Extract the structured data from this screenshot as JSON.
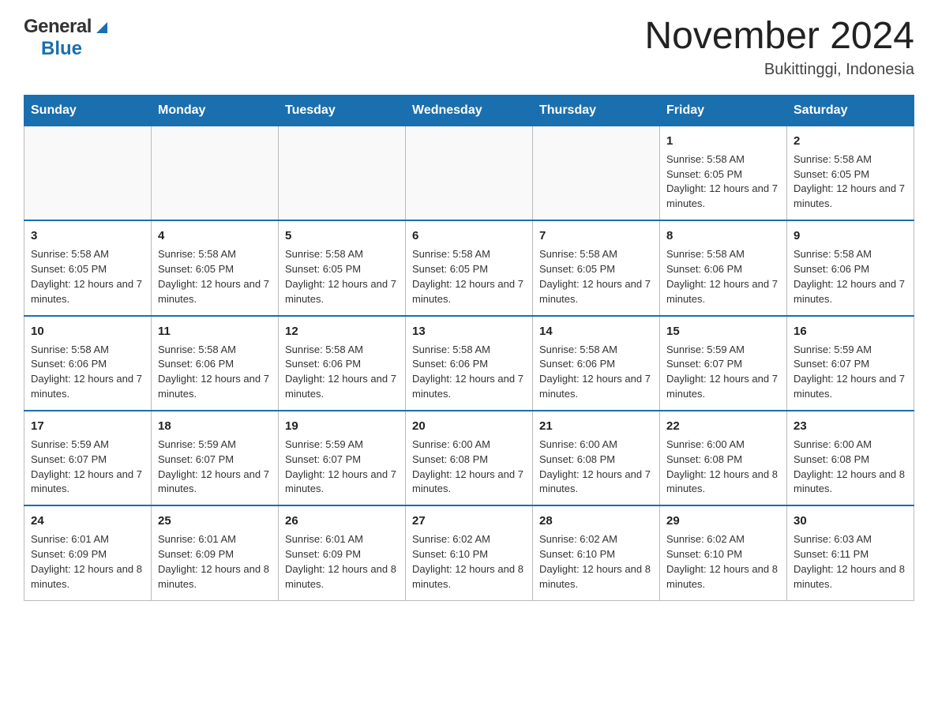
{
  "header": {
    "logo_general": "General",
    "logo_blue": "Blue",
    "title": "November 2024",
    "location": "Bukittinggi, Indonesia"
  },
  "calendar": {
    "days_of_week": [
      "Sunday",
      "Monday",
      "Tuesday",
      "Wednesday",
      "Thursday",
      "Friday",
      "Saturday"
    ],
    "weeks": [
      [
        {
          "day": "",
          "info": ""
        },
        {
          "day": "",
          "info": ""
        },
        {
          "day": "",
          "info": ""
        },
        {
          "day": "",
          "info": ""
        },
        {
          "day": "",
          "info": ""
        },
        {
          "day": "1",
          "info": "Sunrise: 5:58 AM\nSunset: 6:05 PM\nDaylight: 12 hours and 7 minutes."
        },
        {
          "day": "2",
          "info": "Sunrise: 5:58 AM\nSunset: 6:05 PM\nDaylight: 12 hours and 7 minutes."
        }
      ],
      [
        {
          "day": "3",
          "info": "Sunrise: 5:58 AM\nSunset: 6:05 PM\nDaylight: 12 hours and 7 minutes."
        },
        {
          "day": "4",
          "info": "Sunrise: 5:58 AM\nSunset: 6:05 PM\nDaylight: 12 hours and 7 minutes."
        },
        {
          "day": "5",
          "info": "Sunrise: 5:58 AM\nSunset: 6:05 PM\nDaylight: 12 hours and 7 minutes."
        },
        {
          "day": "6",
          "info": "Sunrise: 5:58 AM\nSunset: 6:05 PM\nDaylight: 12 hours and 7 minutes."
        },
        {
          "day": "7",
          "info": "Sunrise: 5:58 AM\nSunset: 6:05 PM\nDaylight: 12 hours and 7 minutes."
        },
        {
          "day": "8",
          "info": "Sunrise: 5:58 AM\nSunset: 6:06 PM\nDaylight: 12 hours and 7 minutes."
        },
        {
          "day": "9",
          "info": "Sunrise: 5:58 AM\nSunset: 6:06 PM\nDaylight: 12 hours and 7 minutes."
        }
      ],
      [
        {
          "day": "10",
          "info": "Sunrise: 5:58 AM\nSunset: 6:06 PM\nDaylight: 12 hours and 7 minutes."
        },
        {
          "day": "11",
          "info": "Sunrise: 5:58 AM\nSunset: 6:06 PM\nDaylight: 12 hours and 7 minutes."
        },
        {
          "day": "12",
          "info": "Sunrise: 5:58 AM\nSunset: 6:06 PM\nDaylight: 12 hours and 7 minutes."
        },
        {
          "day": "13",
          "info": "Sunrise: 5:58 AM\nSunset: 6:06 PM\nDaylight: 12 hours and 7 minutes."
        },
        {
          "day": "14",
          "info": "Sunrise: 5:58 AM\nSunset: 6:06 PM\nDaylight: 12 hours and 7 minutes."
        },
        {
          "day": "15",
          "info": "Sunrise: 5:59 AM\nSunset: 6:07 PM\nDaylight: 12 hours and 7 minutes."
        },
        {
          "day": "16",
          "info": "Sunrise: 5:59 AM\nSunset: 6:07 PM\nDaylight: 12 hours and 7 minutes."
        }
      ],
      [
        {
          "day": "17",
          "info": "Sunrise: 5:59 AM\nSunset: 6:07 PM\nDaylight: 12 hours and 7 minutes."
        },
        {
          "day": "18",
          "info": "Sunrise: 5:59 AM\nSunset: 6:07 PM\nDaylight: 12 hours and 7 minutes."
        },
        {
          "day": "19",
          "info": "Sunrise: 5:59 AM\nSunset: 6:07 PM\nDaylight: 12 hours and 7 minutes."
        },
        {
          "day": "20",
          "info": "Sunrise: 6:00 AM\nSunset: 6:08 PM\nDaylight: 12 hours and 7 minutes."
        },
        {
          "day": "21",
          "info": "Sunrise: 6:00 AM\nSunset: 6:08 PM\nDaylight: 12 hours and 7 minutes."
        },
        {
          "day": "22",
          "info": "Sunrise: 6:00 AM\nSunset: 6:08 PM\nDaylight: 12 hours and 8 minutes."
        },
        {
          "day": "23",
          "info": "Sunrise: 6:00 AM\nSunset: 6:08 PM\nDaylight: 12 hours and 8 minutes."
        }
      ],
      [
        {
          "day": "24",
          "info": "Sunrise: 6:01 AM\nSunset: 6:09 PM\nDaylight: 12 hours and 8 minutes."
        },
        {
          "day": "25",
          "info": "Sunrise: 6:01 AM\nSunset: 6:09 PM\nDaylight: 12 hours and 8 minutes."
        },
        {
          "day": "26",
          "info": "Sunrise: 6:01 AM\nSunset: 6:09 PM\nDaylight: 12 hours and 8 minutes."
        },
        {
          "day": "27",
          "info": "Sunrise: 6:02 AM\nSunset: 6:10 PM\nDaylight: 12 hours and 8 minutes."
        },
        {
          "day": "28",
          "info": "Sunrise: 6:02 AM\nSunset: 6:10 PM\nDaylight: 12 hours and 8 minutes."
        },
        {
          "day": "29",
          "info": "Sunrise: 6:02 AM\nSunset: 6:10 PM\nDaylight: 12 hours and 8 minutes."
        },
        {
          "day": "30",
          "info": "Sunrise: 6:03 AM\nSunset: 6:11 PM\nDaylight: 12 hours and 8 minutes."
        }
      ]
    ]
  }
}
